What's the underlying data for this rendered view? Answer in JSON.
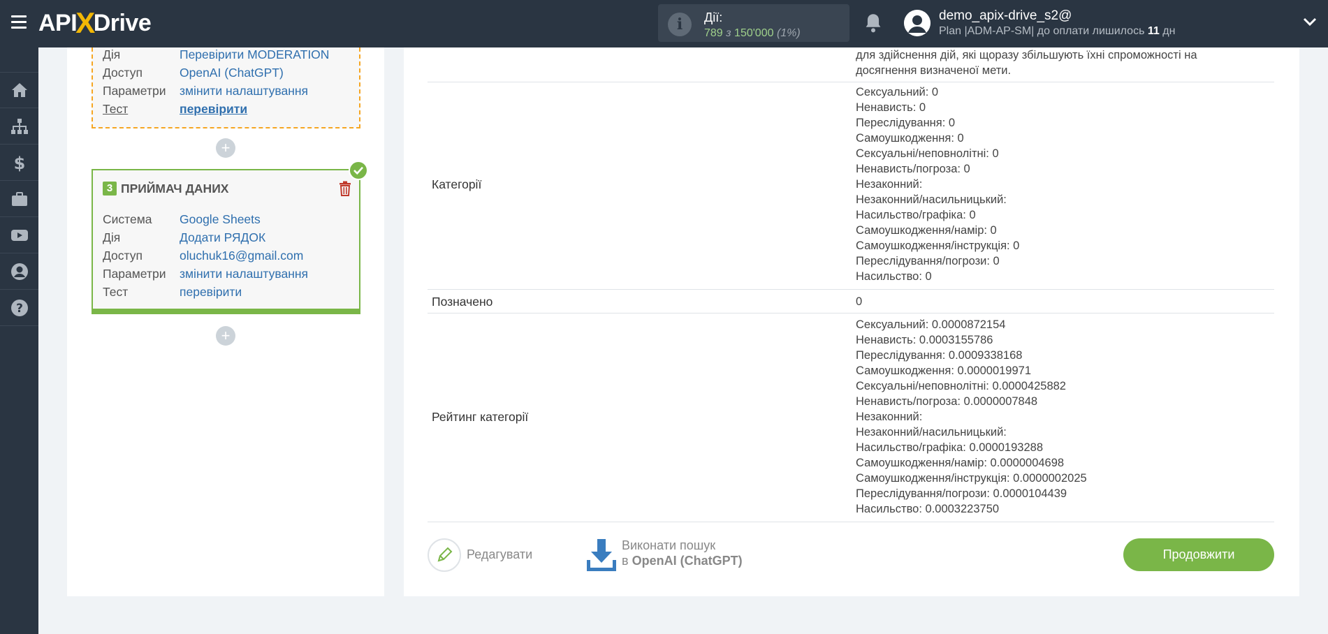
{
  "header": {
    "logo": {
      "left": "API",
      "x": "X",
      "right": "Drive"
    },
    "actions": {
      "label": "Дії:",
      "used": "789",
      "separator": "з",
      "total": "150'000",
      "percent": "(1%)"
    },
    "user": {
      "name": "demo_apix-drive_s2@",
      "plan_prefix": "Plan |ADM-AP-SM| до оплати лишилось",
      "days": "11",
      "days_suffix": "дн"
    }
  },
  "sidebar": {
    "items": [
      {
        "icon": "home-icon"
      },
      {
        "icon": "sitemap-icon"
      },
      {
        "icon": "dollar-icon"
      },
      {
        "icon": "briefcase-icon"
      },
      {
        "icon": "youtube-icon"
      },
      {
        "icon": "user-icon"
      },
      {
        "icon": "help-icon"
      }
    ]
  },
  "step2": {
    "rows": [
      {
        "key": "Дія",
        "value": "Перевірити MODERATION"
      },
      {
        "key": "Доступ",
        "value": "OpenAI (ChatGPT)"
      },
      {
        "key": "Параметри",
        "value": "змінити налаштування"
      },
      {
        "key": "Тест",
        "value": "перевірити"
      }
    ]
  },
  "step3": {
    "number": "3",
    "title": "ПРИЙМАЧ ДАНИХ",
    "rows": [
      {
        "key": "Система",
        "value": "Google Sheets"
      },
      {
        "key": "Дія",
        "value": "Додати РЯДОК"
      },
      {
        "key": "Доступ",
        "value": "oluchuk16@gmail.com"
      },
      {
        "key": "Параметри",
        "value": "змінити налаштування"
      },
      {
        "key": "Тест",
        "value": "перевірити"
      }
    ]
  },
  "result": {
    "top_text": [
      "для здійснення дій, які щоразу збільшують їхні спроможності на",
      "досягнення визначеної мети."
    ],
    "categories_label": "Категорії",
    "categories": [
      "Сексуальний: 0",
      "Ненависть: 0",
      "Переслідування: 0",
      "Самоушкодження: 0",
      "Сексуальні/неповнолітні: 0",
      "Ненависть/погроза: 0",
      "Незаконний:",
      "Незаконний/насильницький:",
      "Насильство/графіка: 0",
      "Самоушкодження/намір: 0",
      "Самоушкодження/інструкція: 0",
      "Переслідування/погрози: 0",
      "Насильство: 0"
    ],
    "flagged_label": "Позначено",
    "flagged_value": "0",
    "scores_label": "Рейтинг категорії",
    "scores": [
      "Сексуальний: 0.0000872154",
      "Ненависть: 0.0003155786",
      "Переслідування: 0.0009338168",
      "Самоушкодження: 0.0000019971",
      "Сексуальні/неповнолітні: 0.0000425882",
      "Ненависть/погроза: 0.0000007848",
      "Незаконний:",
      "Незаконний/насильницький:",
      "Насильство/графіка: 0.0000193288",
      "Самоушкодження/намір: 0.0000004698",
      "Самоушкодження/інструкція: 0.0000002025",
      "Переслідування/погрози: 0.0000104439",
      "Насильство: 0.0003223750"
    ]
  },
  "footer": {
    "edit_label": "Редагувати",
    "search_line1": "Виконати пошук",
    "search_prefix": "в",
    "search_target": "OpenAI (ChatGPT)",
    "continue_label": "Продовжити"
  },
  "colors": {
    "topbar": "#2a3542",
    "accent_green": "#7ab648",
    "accent_orange": "#f5a623",
    "link_blue": "#2f6fae",
    "download_blue": "#3a7dbf",
    "delete_red": "#c0392b"
  }
}
